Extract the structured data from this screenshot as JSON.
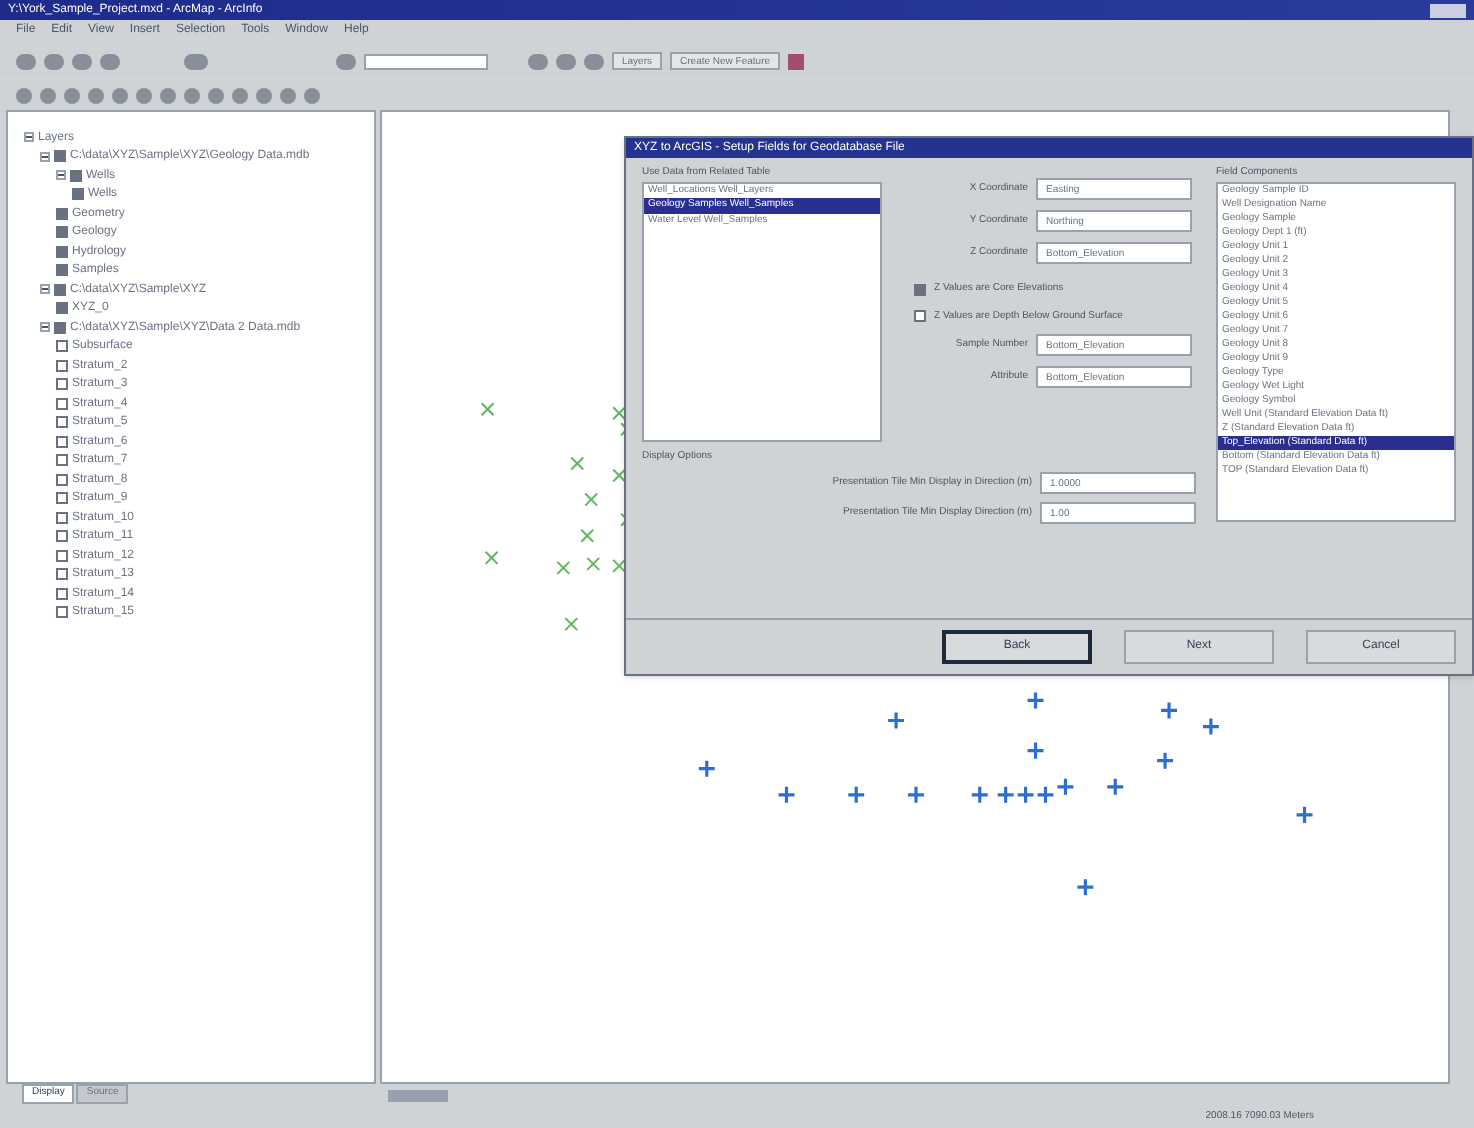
{
  "window": {
    "title": "Y:\\York_Sample_Project.mxd - ArcMap - ArcInfo"
  },
  "menu": [
    "File",
    "Edit",
    "View",
    "Insert",
    "Selection",
    "Tools",
    "Window",
    "Help"
  ],
  "toolbar": {
    "layer_dropdown": "Layers",
    "target_dropdown": "Create New Feature"
  },
  "toc": {
    "items": [
      {
        "label": "Layers",
        "expanded": true,
        "children": [
          {
            "label": "C:\\data\\XYZ\\Sample\\XYZ\\Geology Data.mdb",
            "checked": true,
            "expanded": true,
            "children": [
              {
                "label": "Wells",
                "checked": true,
                "expanded": true,
                "children": [
                  {
                    "label": "Wells",
                    "checked": true
                  }
                ]
              },
              {
                "label": "Geometry",
                "checked": true
              },
              {
                "label": "Geology",
                "checked": true
              },
              {
                "label": "Hydrology",
                "checked": true
              },
              {
                "label": "Samples",
                "checked": true
              }
            ]
          },
          {
            "label": "C:\\data\\XYZ\\Sample\\XYZ",
            "checked": true,
            "expanded": true,
            "children": [
              {
                "label": "XYZ_0",
                "checked": true
              }
            ]
          },
          {
            "label": "C:\\data\\XYZ\\Sample\\XYZ\\Data 2 Data.mdb",
            "checked": true,
            "expanded": true,
            "children": [
              {
                "label": "Subsurface",
                "checked": false
              },
              {
                "label": "Stratum_2",
                "checked": false
              },
              {
                "label": "Stratum_3",
                "checked": false
              },
              {
                "label": "Stratum_4",
                "checked": false
              },
              {
                "label": "Stratum_5",
                "checked": false
              },
              {
                "label": "Stratum_6",
                "checked": false
              },
              {
                "label": "Stratum_7",
                "checked": false
              },
              {
                "label": "Stratum_8",
                "checked": false
              },
              {
                "label": "Stratum_9",
                "checked": false
              },
              {
                "label": "Stratum_10",
                "checked": false
              },
              {
                "label": "Stratum_11",
                "checked": false
              },
              {
                "label": "Stratum_12",
                "checked": false
              },
              {
                "label": "Stratum_13",
                "checked": false
              },
              {
                "label": "Stratum_14",
                "checked": false
              },
              {
                "label": "Stratum_15",
                "checked": false
              }
            ]
          }
        ]
      }
    ],
    "tabs": [
      {
        "label": "Display",
        "selected": true
      },
      {
        "label": "Source",
        "selected": false
      }
    ]
  },
  "dialog": {
    "title": "XYZ to ArcGIS - Setup Fields for Geodatabase File",
    "tables_label": "Use Data from Related Table",
    "tables": [
      {
        "label": "Well_Locations Well_Layers",
        "selected": false
      },
      {
        "label": "Geology Samples Well_Samples",
        "selected": true
      },
      {
        "label": "Water Level Well_Samples",
        "selected": false
      }
    ],
    "coords": [
      {
        "label": "X Coordinate",
        "value": "Easting"
      },
      {
        "label": "Y Coordinate",
        "value": "Northing"
      },
      {
        "label": "Z Coordinate",
        "value": "Bottom_Elevation"
      }
    ],
    "options": [
      {
        "label": "Z Values are Core Elevations",
        "checked": true
      },
      {
        "label": "Z Values are Depth Below Ground Surface",
        "checked": false
      }
    ],
    "selects": [
      {
        "label": "Sample Number",
        "value": "Bottom_Elevation"
      },
      {
        "label": "Attribute",
        "value": "Bottom_Elevation"
      }
    ],
    "group_label": "Display Options",
    "fields": [
      {
        "label": "Presentation Tile Min Display in Direction (m)",
        "value": "1.0000"
      },
      {
        "label": "Presentation Tile Min Display Direction (m)",
        "value": "1.00"
      }
    ],
    "components_label": "Field Components",
    "components": [
      {
        "label": "Geology Sample ID",
        "selected": false
      },
      {
        "label": "Well Designation Name",
        "selected": false
      },
      {
        "label": "Geology Sample",
        "selected": false
      },
      {
        "label": "Geology Dept 1 (ft)",
        "selected": false
      },
      {
        "label": "Geology Unit 1",
        "selected": false
      },
      {
        "label": "Geology Unit 2",
        "selected": false
      },
      {
        "label": "Geology Unit 3",
        "selected": false
      },
      {
        "label": "Geology Unit 4",
        "selected": false
      },
      {
        "label": "Geology Unit 5",
        "selected": false
      },
      {
        "label": "Geology Unit 6",
        "selected": false
      },
      {
        "label": "Geology Unit 7",
        "selected": false
      },
      {
        "label": "Geology Unit 8",
        "selected": false
      },
      {
        "label": "Geology Unit 9",
        "selected": false
      },
      {
        "label": "Geology Type",
        "selected": false
      },
      {
        "label": "Geology Wet Light",
        "selected": false
      },
      {
        "label": "Geology Symbol",
        "selected": false
      },
      {
        "label": "Well Unit (Standard Elevation Data ft)",
        "selected": false
      },
      {
        "label": "Z (Standard Elevation Data ft)",
        "selected": false
      },
      {
        "label": "Top_Elevation (Standard Data ft)",
        "selected": true
      },
      {
        "label": "Bottom (Standard Elevation Data ft)",
        "selected": false
      },
      {
        "label": "TOP (Standard Elevation Data ft)",
        "selected": false
      }
    ],
    "buttons": [
      {
        "label": "Back",
        "default": true
      },
      {
        "label": "Next",
        "default": false
      },
      {
        "label": "Cancel",
        "default": false
      }
    ]
  },
  "status_bar": {
    "coordinates": "2008.16  7090.03 Meters"
  }
}
